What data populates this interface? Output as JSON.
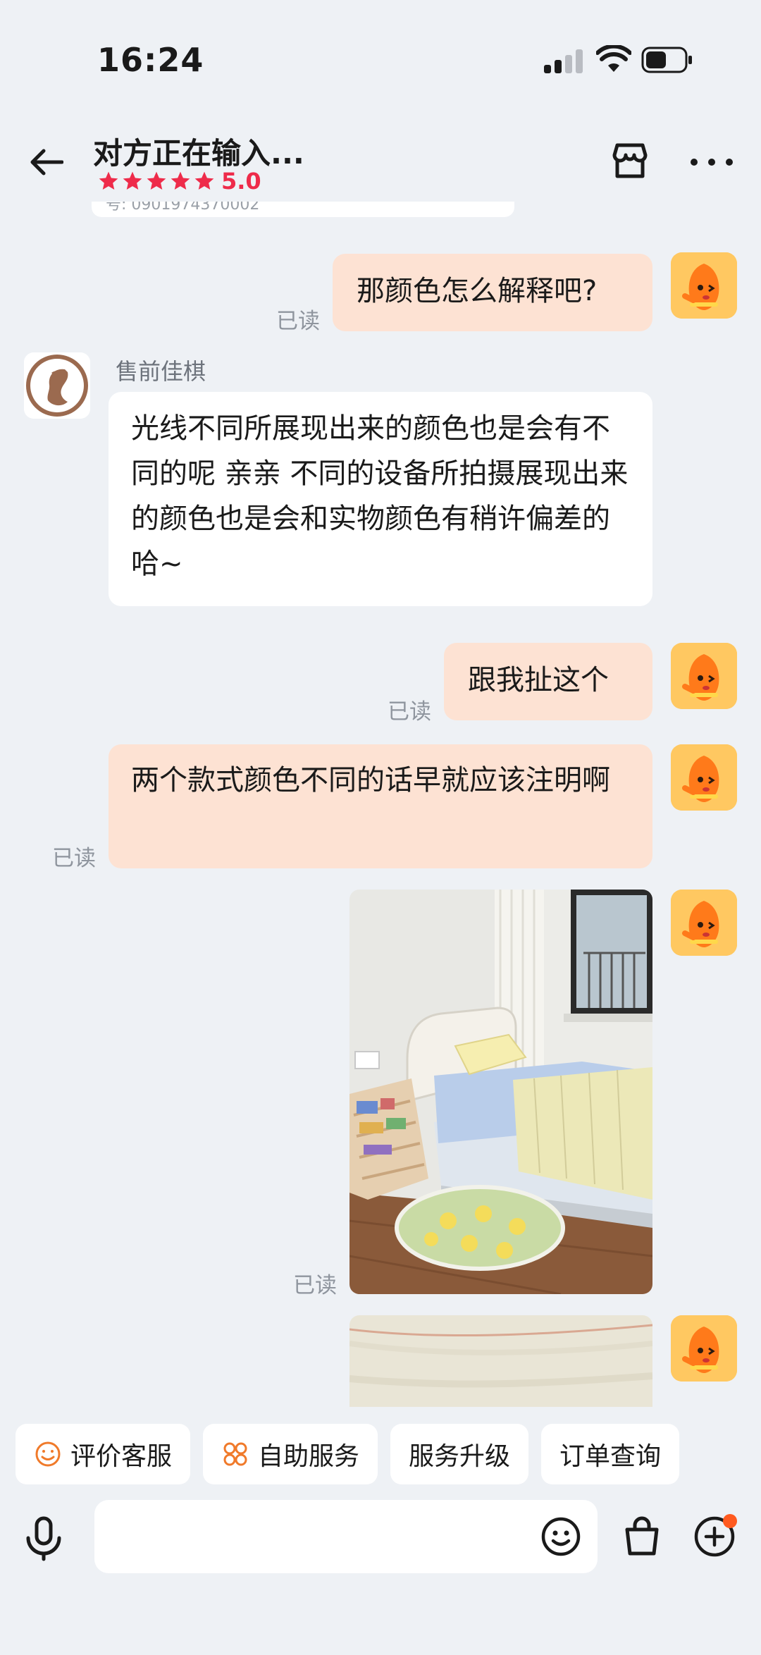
{
  "status_bar": {
    "time": "16:24"
  },
  "header": {
    "title": "对方正在输入...",
    "rating": "5.0",
    "stars": 5
  },
  "previous_sliver": "号: 0901974370002",
  "messages": [
    {
      "side": "out",
      "text": "那颜色怎么解释吧?",
      "read": "已读"
    },
    {
      "side": "in",
      "sender": "售前佳棋",
      "text": "光线不同所展现出来的颜色也是会有不同的呢 亲亲 不同的设备所拍摄展现出来的颜色也是会和实物颜色有稍许偏差的哈~"
    },
    {
      "side": "out",
      "text": "跟我扯这个",
      "read": "已读"
    },
    {
      "side": "out",
      "text": "两个款式颜色不同的话早就应该注明啊",
      "read": "已读"
    },
    {
      "side": "out",
      "type": "image",
      "read": "已读"
    },
    {
      "side": "out",
      "type": "image"
    }
  ],
  "quick_replies": [
    {
      "label": "评价客服",
      "icon": "smile-icon"
    },
    {
      "label": "自助服务",
      "icon": "grid-icon"
    },
    {
      "label": "服务升级",
      "icon": ""
    },
    {
      "label": "订单查询",
      "icon": ""
    }
  ],
  "input": {
    "placeholder": ""
  },
  "colors": {
    "background": "#eef1f5",
    "outgoing_bubble": "#fde2d3",
    "incoming_bubble": "#ffffff",
    "rating_red": "#ee2b4a",
    "notification_dot": "#ff5a1f"
  }
}
